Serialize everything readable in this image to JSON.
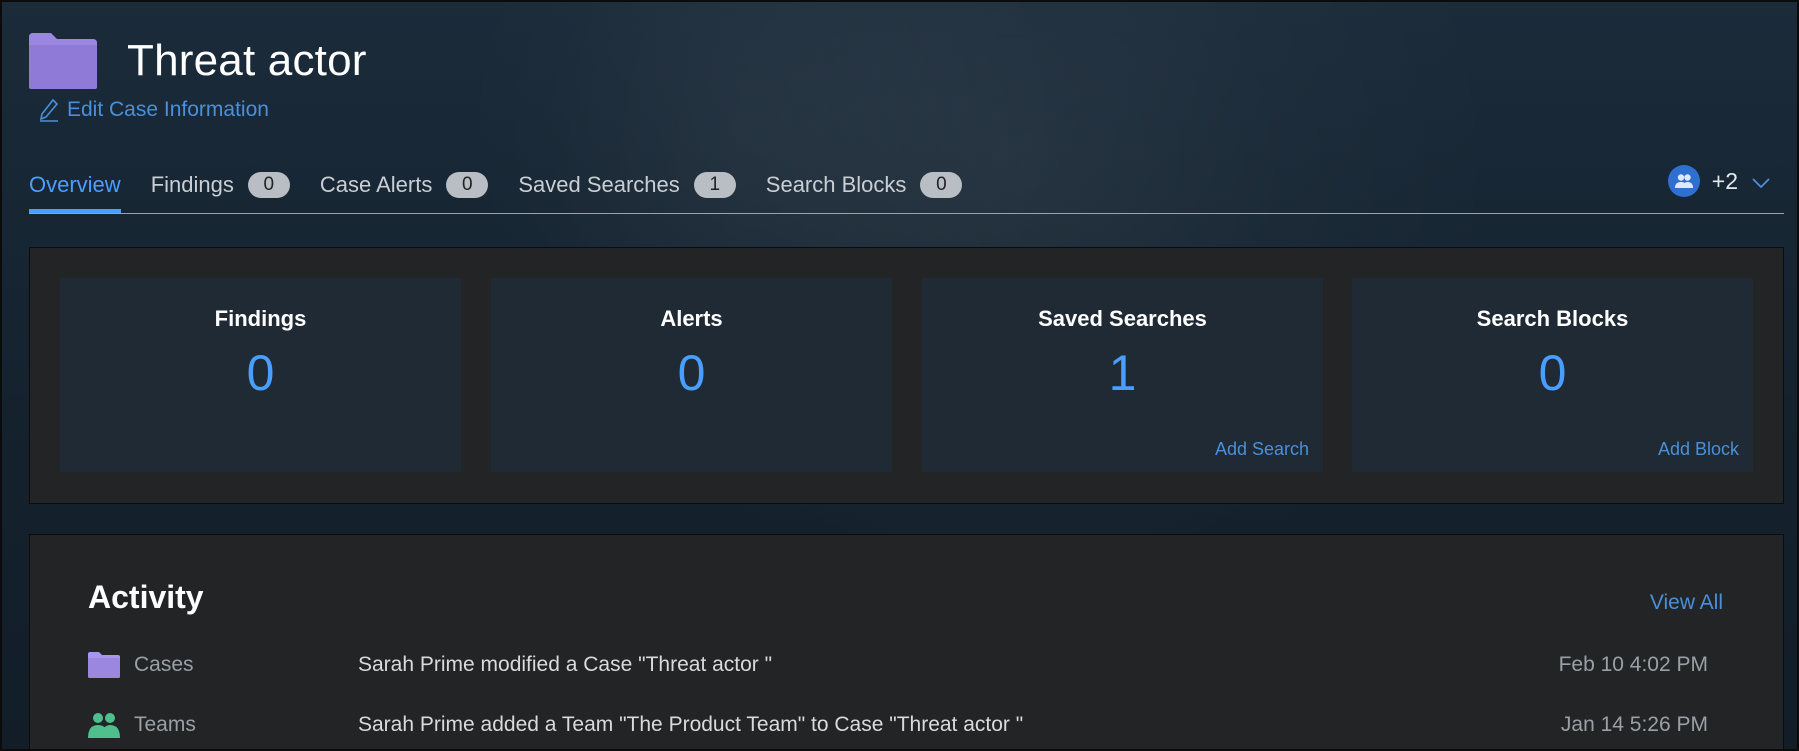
{
  "header": {
    "title": "Threat actor",
    "edit_label": "Edit Case Information"
  },
  "tabs": [
    {
      "label": "Overview",
      "active": true
    },
    {
      "label": "Findings",
      "count": "0"
    },
    {
      "label": "Case Alerts",
      "count": "0"
    },
    {
      "label": "Saved Searches",
      "count": "1"
    },
    {
      "label": "Search Blocks",
      "count": "0"
    }
  ],
  "members": {
    "extra_count": "+2",
    "icon": "users-icon"
  },
  "stats": [
    {
      "label": "Findings",
      "value": "0",
      "action": ""
    },
    {
      "label": "Alerts",
      "value": "0",
      "action": ""
    },
    {
      "label": "Saved Searches",
      "value": "1",
      "action": "Add Search"
    },
    {
      "label": "Search Blocks",
      "value": "0",
      "action": "Add Block"
    }
  ],
  "activity": {
    "title": "Activity",
    "view_all": "View All",
    "rows": [
      {
        "icon": "folder-icon",
        "type": "Cases",
        "description": "Sarah Prime modified a Case \"Threat actor \"",
        "time": "Feb 10 4:02 PM"
      },
      {
        "icon": "team-icon",
        "type": "Teams",
        "description": "Sarah Prime added a Team \"The Product Team\" to Case \"Threat actor \"",
        "time": "Jan 14 5:26 PM"
      }
    ]
  },
  "colors": {
    "accent": "#4a9eff",
    "folder": "#9b86e0",
    "team": "#4fc08d",
    "panel": "#222426",
    "card": "#1f2a35"
  }
}
